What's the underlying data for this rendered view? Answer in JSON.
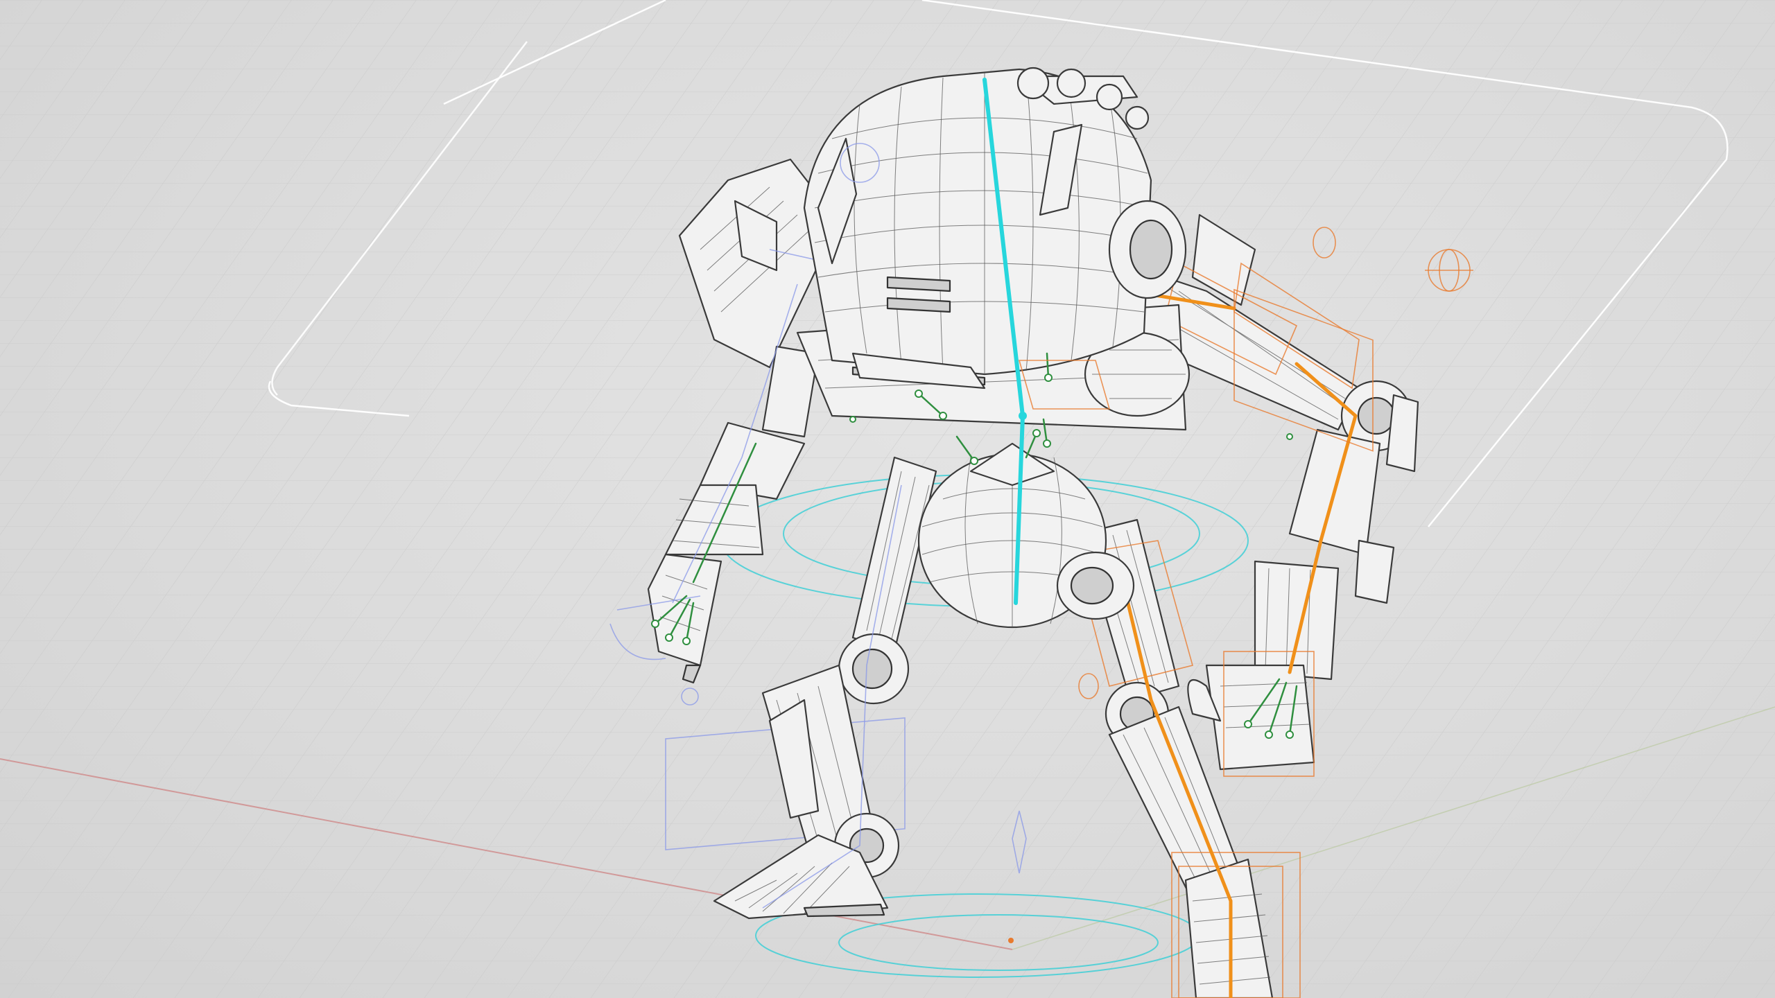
{
  "scene": {
    "type": "3d-viewport",
    "subject": "rigged-mech-robot",
    "display_mode": "wireframe-on-shaded",
    "colors": {
      "background": "#dcdcdc",
      "grid": "#c8c8c8",
      "mesh_fill": "#f2f2f2",
      "mesh_edge": "#3a3a3a",
      "spine_bone": "#27d6dc",
      "right_side_bone": "#f0901a",
      "left_side_control": "#8a98e8",
      "finger_bone": "#2f8f3f",
      "x_axis": "#d08a8a"
    }
  }
}
